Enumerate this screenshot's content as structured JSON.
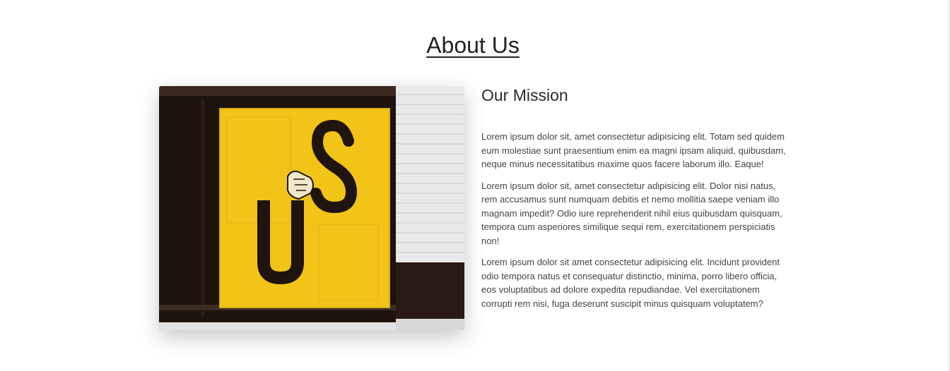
{
  "section": {
    "title": "About Us"
  },
  "mission": {
    "title": "Our Mission",
    "paragraphs": [
      "Lorem ipsum dolor sit, amet consectetur adipisicing elit. Totam sed quidem eum molestiae sunt praesentium enim ea magni ipsam aliquid, quibusdam, neque minus necessitatibus maxime quos facere laborum illo. Eaque!",
      "Lorem ipsum dolor sit, amet consectetur adipisicing elit. Dolor nisi natus, rem accusamus sunt numquam debitis et nemo mollitia saepe veniam illo magnam impedit? Odio iure reprehenderit nihil eius quibusdam quisquam, tempora cum asperiores similique sequi rem, exercitationem perspiciatis non!",
      "Lorem ipsum dolor sit amet consectetur adipisicing elit. Incidunt provident odio tempora natus et consequatur distinctio, minima, porro libero officia, eos voluptatibus ad dolore expedita repudiandae. Vel exercitationem corrupti rem nisi, fuga deserunt suscipit minus quisquam voluptatem?"
    ]
  },
  "image": {
    "letters": "US",
    "colors": {
      "door": "#f2c418",
      "frame": "#1e120d",
      "brick": "#e6e6e6",
      "letter": "#1f140e"
    }
  }
}
